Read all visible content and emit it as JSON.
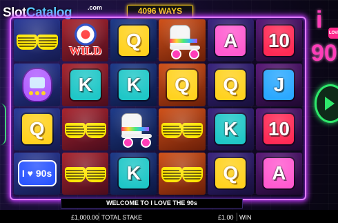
{
  "header": {
    "logo_slot": "Slot",
    "logo_catalog": "Catalog",
    "logo_com": ".com",
    "ways_badge": "4096 WAYS"
  },
  "brand": {
    "i": "i",
    "heart": "LOVE",
    "nineties": "90"
  },
  "reels": [
    [
      {
        "symbol": "sunglasses",
        "icon": "sunglasses-icon"
      },
      {
        "symbol": "tamagotchi",
        "icon": "tamagotchi-icon"
      },
      {
        "symbol": "Q",
        "label": "Q",
        "tile": "q"
      },
      {
        "symbol": "i-love-90s",
        "label": "I ♥ 90s"
      }
    ],
    [
      {
        "symbol": "wild",
        "label": "WILD",
        "icon": "mod-roundel-icon"
      },
      {
        "symbol": "K",
        "label": "K",
        "tile": "k"
      },
      {
        "symbol": "sunglasses",
        "icon": "sunglasses-icon"
      },
      {
        "symbol": "sunglasses",
        "icon": "sunglasses-icon"
      }
    ],
    [
      {
        "symbol": "Q",
        "label": "Q",
        "tile": "q"
      },
      {
        "symbol": "K",
        "label": "K",
        "tile": "k"
      },
      {
        "symbol": "roller-skate",
        "icon": "roller-skate-icon"
      },
      {
        "symbol": "K",
        "label": "K",
        "tile": "k"
      }
    ],
    [
      {
        "symbol": "roller-skate",
        "icon": "roller-skate-icon"
      },
      {
        "symbol": "Q",
        "label": "Q",
        "tile": "q"
      },
      {
        "symbol": "sunglasses",
        "icon": "sunglasses-icon"
      },
      {
        "symbol": "sunglasses",
        "icon": "sunglasses-icon"
      }
    ],
    [
      {
        "symbol": "A",
        "label": "A",
        "tile": "a"
      },
      {
        "symbol": "Q",
        "label": "Q",
        "tile": "q"
      },
      {
        "symbol": "K",
        "label": "K",
        "tile": "k"
      },
      {
        "symbol": "Q",
        "label": "Q",
        "tile": "q"
      }
    ],
    [
      {
        "symbol": "10",
        "label": "10",
        "tile": "10"
      },
      {
        "symbol": "J",
        "label": "J",
        "tile": "j"
      },
      {
        "symbol": "10",
        "label": "10",
        "tile": "10"
      },
      {
        "symbol": "A",
        "label": "A",
        "tile": "a"
      }
    ]
  ],
  "message_bar": "WELCOME TO I LOVE THE 90s",
  "footer": {
    "balance_value": "£1,000.00",
    "stake_label": "TOTAL STAKE",
    "stake_value": "£1.00",
    "win_label": "WIN"
  },
  "colors": {
    "neon_frame": "#e07cff",
    "ways_gold": "#ffd21f",
    "spin_green": "#2ee86b",
    "brand_pink": "#ff3db8"
  }
}
